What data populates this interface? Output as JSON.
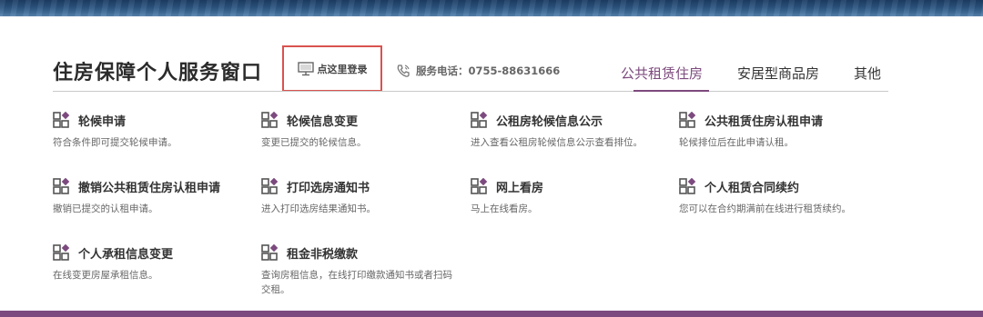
{
  "header": {
    "title": "住房保障个人服务窗口",
    "login_label": "点这里登录",
    "phone_label": "服务电话：0755-88631666"
  },
  "tabs": [
    {
      "label": "公共租赁住房",
      "active": true
    },
    {
      "label": "安居型商品房",
      "active": false
    },
    {
      "label": "其他",
      "active": false
    }
  ],
  "services": [
    {
      "title": "轮候申请",
      "desc": "符合条件即可提交轮候申请。"
    },
    {
      "title": "轮候信息变更",
      "desc": "变更已提交的轮候信息。"
    },
    {
      "title": "公租房轮候信息公示",
      "desc": "进入查看公租房轮候信息公示查看排位。"
    },
    {
      "title": "公共租赁住房认租申请",
      "desc": "轮候排位后在此申请认租。"
    },
    {
      "title": "撤销公共租赁住房认租申请",
      "desc": "撤销已提交的认租申请。"
    },
    {
      "title": "打印选房通知书",
      "desc": "进入打印选房结果通知书。"
    },
    {
      "title": "网上看房",
      "desc": "马上在线看房。"
    },
    {
      "title": "个人租赁合同续约",
      "desc": "您可以在合约期满前在线进行租赁续约。"
    },
    {
      "title": "个人承租信息变更",
      "desc": "在线变更房屋承租信息。"
    },
    {
      "title": "租金非税缴款",
      "desc": "查询房租信息，在线打印缴款通知书或者扫码交租。"
    }
  ],
  "colors": {
    "accent": "#7c4a7e",
    "login_border": "#d9534f",
    "icon_dark": "#555555"
  }
}
